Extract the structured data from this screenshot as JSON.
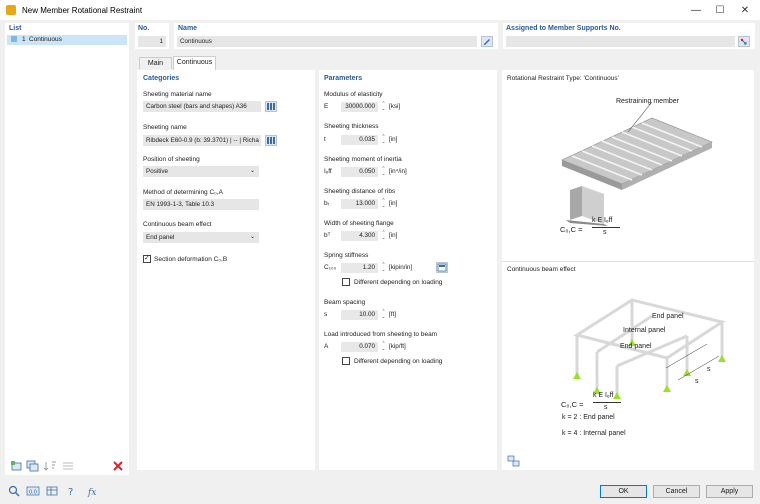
{
  "window": {
    "title": "New Member Rotational Restraint",
    "minimize": "—",
    "maximize": "☐",
    "close": "✕"
  },
  "list": {
    "header": "List",
    "items": [
      {
        "number": "1",
        "name": "Continuous"
      }
    ]
  },
  "top": {
    "no_label": "No.",
    "no_value": "1",
    "name_label": "Name",
    "name_value": "Continuous",
    "assigned_label": "Assigned to Member Supports No.",
    "assigned_value": ""
  },
  "tabs": [
    "Main",
    "Continuous"
  ],
  "categories": {
    "header": "Categories",
    "sheeting_material_label": "Sheeting material name",
    "sheeting_material_value": "Carbon steel (bars and shapes) A36",
    "sheeting_name_label": "Sheeting name",
    "sheeting_name_value": "Ribdeck E60-0.9 (b: 39.3701) | -- | Richa",
    "position_label": "Position of sheeting",
    "position_value": "Positive",
    "method_label": "Method of determining C₀,A",
    "method_value": "EN 1993-1-3, Table 10.3",
    "beam_effect_label": "Continuous beam effect",
    "beam_effect_value": "End panel",
    "section_deformation_label": "Section deformation C₀,B",
    "section_deformation_checked": true
  },
  "parameters": {
    "header": "Parameters",
    "modulus_label": "Modulus of elasticity",
    "modulus_sym": "E",
    "modulus_value": "30000.000",
    "modulus_unit": "[ksi]",
    "thickness_label": "Sheeting thickness",
    "thickness_sym": "t",
    "thickness_value": "0.035",
    "thickness_unit": "[in]",
    "inertia_label": "Sheeting moment of inertia",
    "inertia_sym": "Iₑff",
    "inertia_value": "0.050",
    "inertia_unit": "[in⁴/in]",
    "ribs_label": "Sheeting distance of ribs",
    "ribs_sym": "bᵣ",
    "ribs_value": "13.000",
    "ribs_unit": "[in]",
    "flange_label": "Width of sheeting flange",
    "flange_sym": "bᵀ",
    "flange_value": "4.300",
    "flange_unit": "[in]",
    "spring_label": "Spring stiffness",
    "spring_sym": "C₁₀₀",
    "spring_value": "1.20",
    "spring_unit": "[kipin/in]",
    "spring_diff_label": "Different depending on loading",
    "spring_diff_checked": false,
    "spacing_label": "Beam spacing",
    "spacing_sym": "s",
    "spacing_value": "10.00",
    "spacing_unit": "[ft]",
    "load_label": "Load introduced from sheeting to beam",
    "load_sym": "A",
    "load_value": "0.070",
    "load_unit": "[kip/ft]",
    "load_diff_label": "Different depending on loading",
    "load_diff_checked": false
  },
  "figure": {
    "type_title": "Rotational Restraint Type: 'Continuous'",
    "restraining_label": "Restraining member",
    "formula_lhs": "C₀,C =",
    "formula_num": "k E Iₑff",
    "formula_den": "s",
    "beam_effect_title": "Continuous beam effect",
    "end_panel_top": "End panel",
    "internal_panel": "Internal panel",
    "end_panel_bottom": "End panel",
    "dim_s1": "s",
    "dim_s2": "s",
    "k_end": "k  =  2 : End  panel",
    "k_internal": "k  =  4 : Internal  panel"
  },
  "buttons": {
    "ok": "OK",
    "cancel": "Cancel",
    "apply": "Apply"
  },
  "colors": {
    "accent": "#2a5a9a",
    "selected": "#cce4f7",
    "support_green": "#9be02a"
  }
}
